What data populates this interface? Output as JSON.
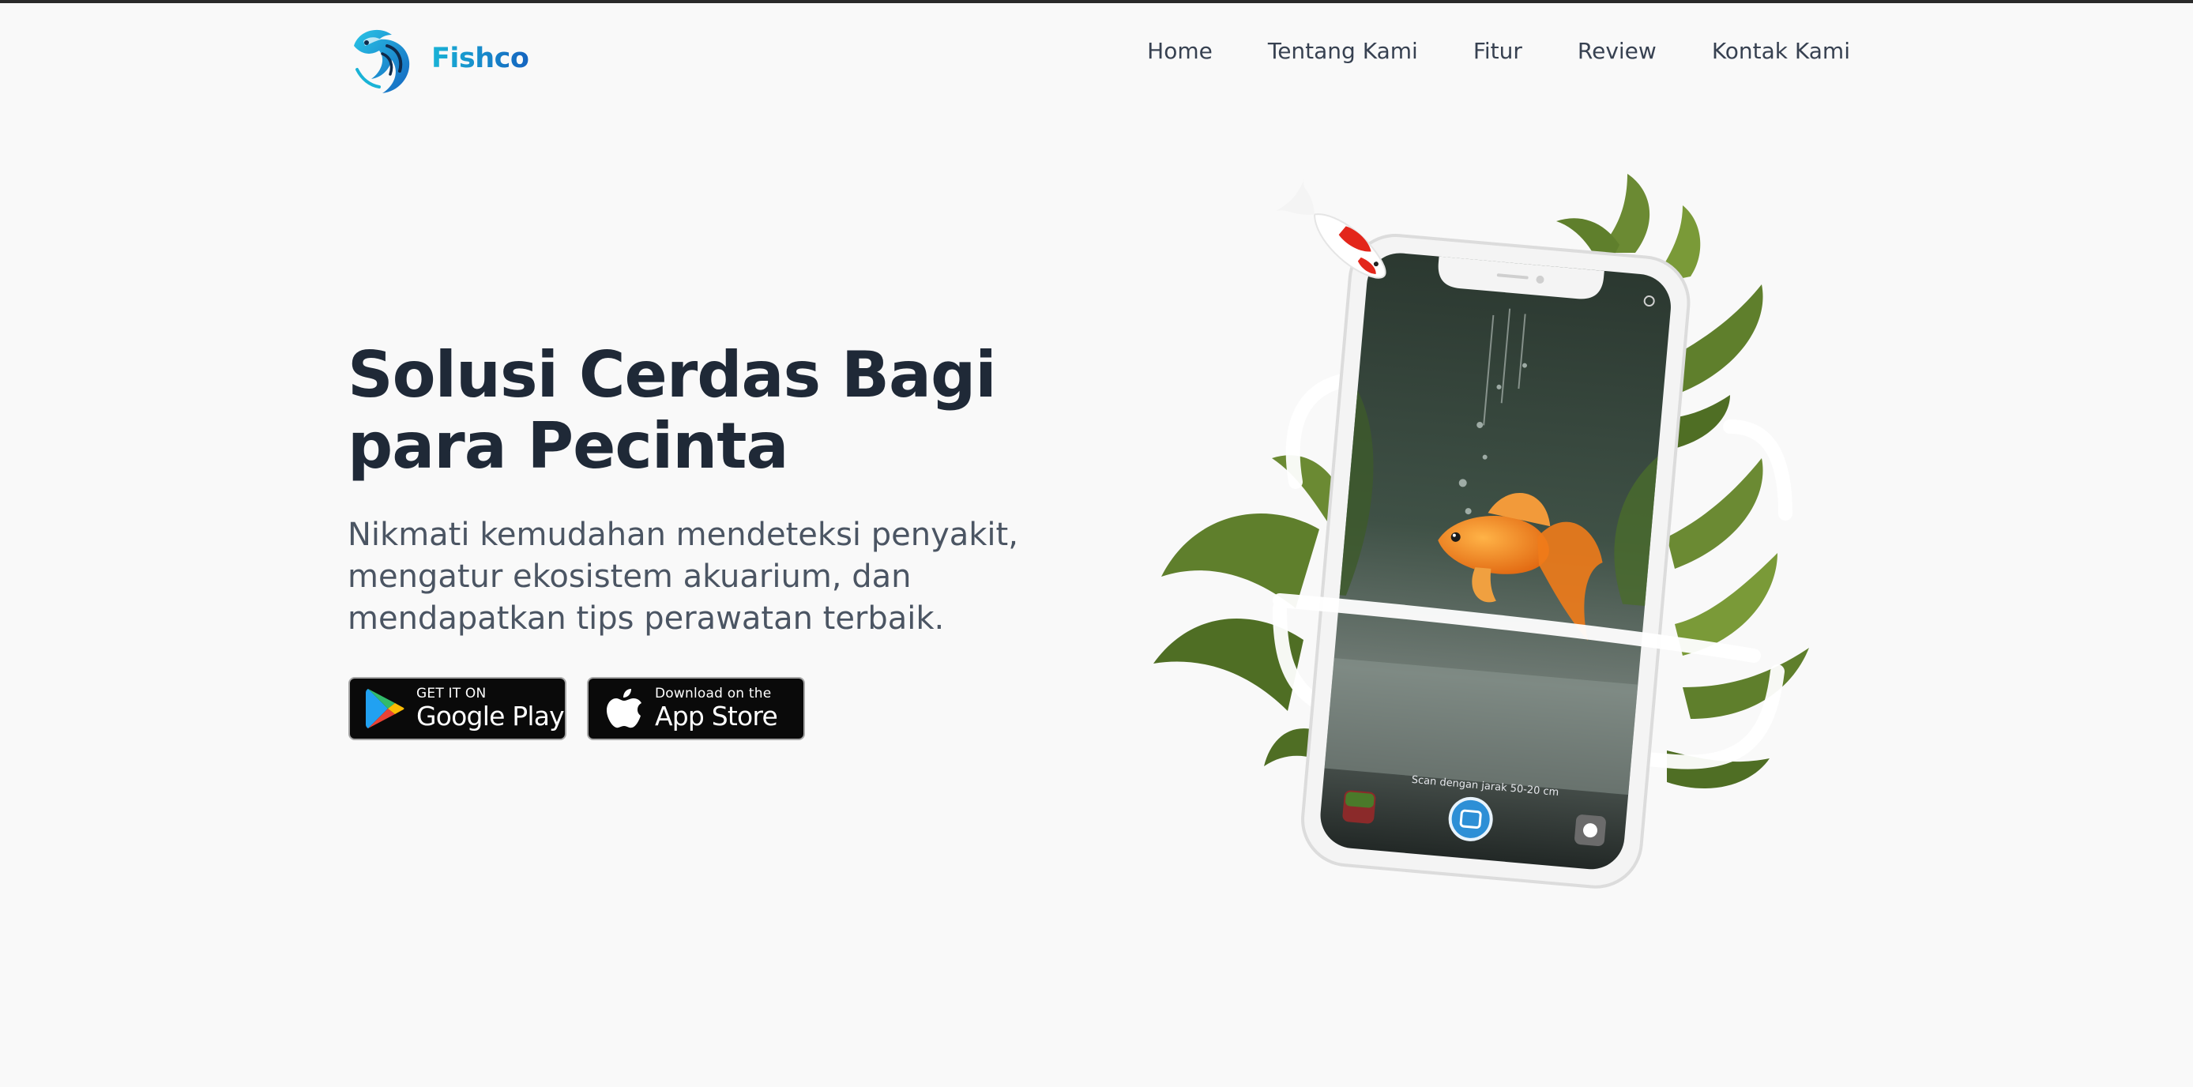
{
  "brand": {
    "name": "Fishco",
    "colors": {
      "brand_cyan": "#1ab3d6",
      "brand_blue": "#1565c0",
      "dark_navy": "#0f2a4a"
    }
  },
  "nav": {
    "items": [
      {
        "label": "Home"
      },
      {
        "label": "Tentang Kami"
      },
      {
        "label": "Fitur"
      },
      {
        "label": "Review"
      },
      {
        "label": "Kontak Kami"
      }
    ]
  },
  "hero": {
    "title": "Solusi Cerdas Bagi para Pecinta",
    "subtitle": "Nikmati kemudahan mendeteksi penyakit, mengatur ekosistem akuarium, dan mendapatkan tips perawatan terbaik."
  },
  "stores": {
    "google_play": {
      "small": "GET IT ON",
      "big": "Google Play",
      "icon": "google-play-icon"
    },
    "app_store": {
      "small": "Download on the",
      "big": "App Store",
      "icon": "apple-icon"
    }
  },
  "phone": {
    "scan_hint": "Scan dengan jarak 50-20 cm",
    "colors": {
      "scan_button": "#2d8fd6",
      "fish": "#f08a1c",
      "plant": "#5b7a2e"
    }
  }
}
